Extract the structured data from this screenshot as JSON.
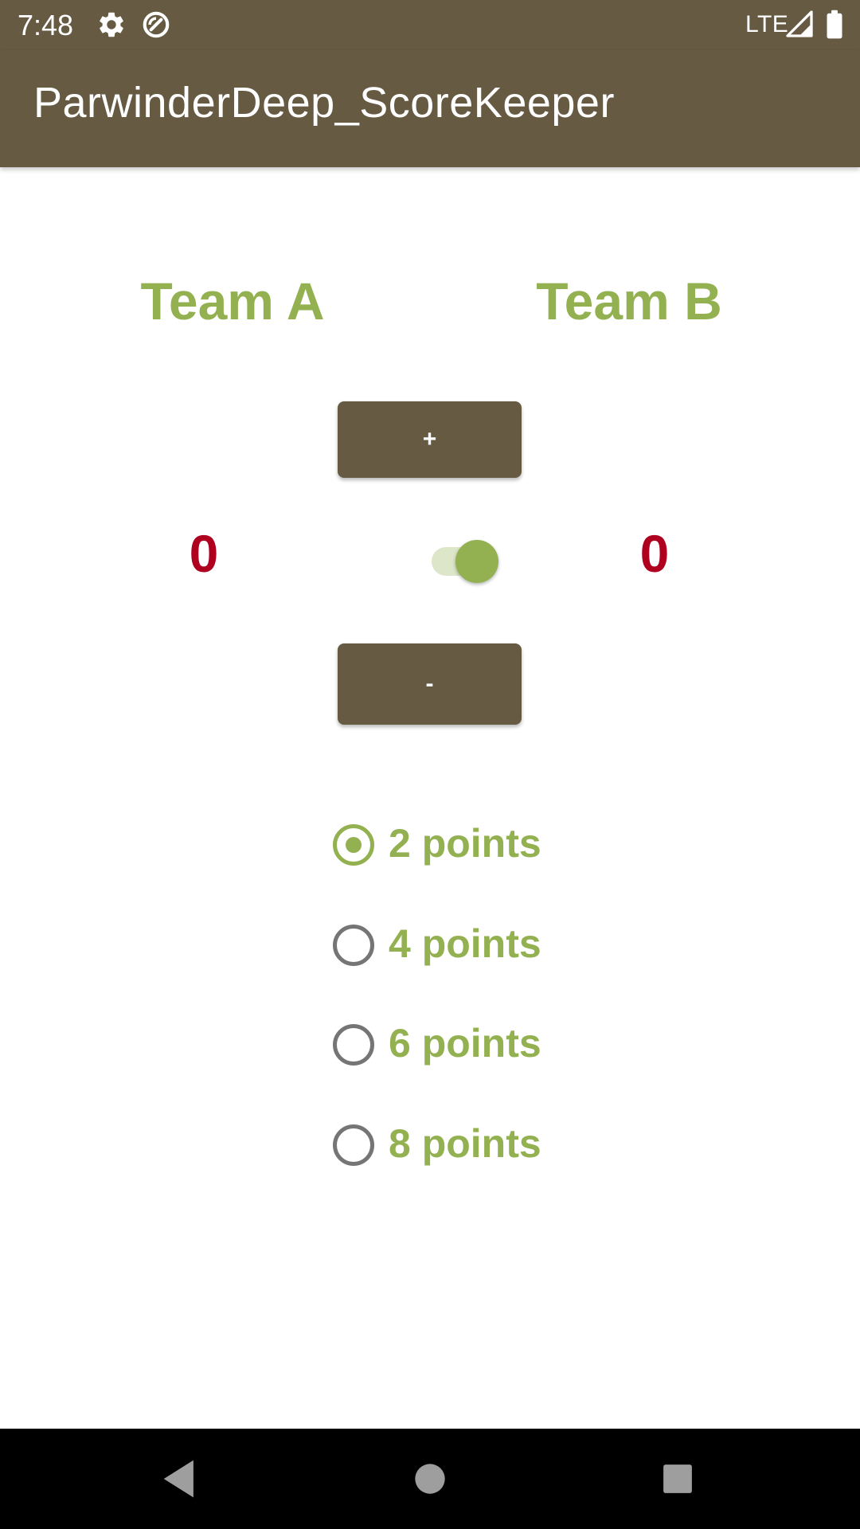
{
  "status_bar": {
    "time": "7:48",
    "network": "LTE",
    "icons": [
      "settings-icon",
      "sync-disabled-icon",
      "signal-icon",
      "battery-icon"
    ]
  },
  "app_bar": {
    "title": "ParwinderDeep_ScoreKeeper"
  },
  "teams": {
    "a": {
      "name": "Team A",
      "score": "0"
    },
    "b": {
      "name": "Team B",
      "score": "0"
    }
  },
  "controls": {
    "plus_label": "+",
    "minus_label": "-",
    "team_switch_on": true
  },
  "points_options": [
    {
      "label": "2 points",
      "checked": true
    },
    {
      "label": "4 points",
      "checked": false
    },
    {
      "label": "6 points",
      "checked": false
    },
    {
      "label": "8 points",
      "checked": false
    }
  ],
  "nav_bar": {
    "icons": [
      "back-icon",
      "home-icon",
      "recents-icon"
    ]
  },
  "colors": {
    "primary": "#665A43",
    "accent": "#93B150",
    "score": "#B00020",
    "switch_track": "#DDE6C8"
  }
}
